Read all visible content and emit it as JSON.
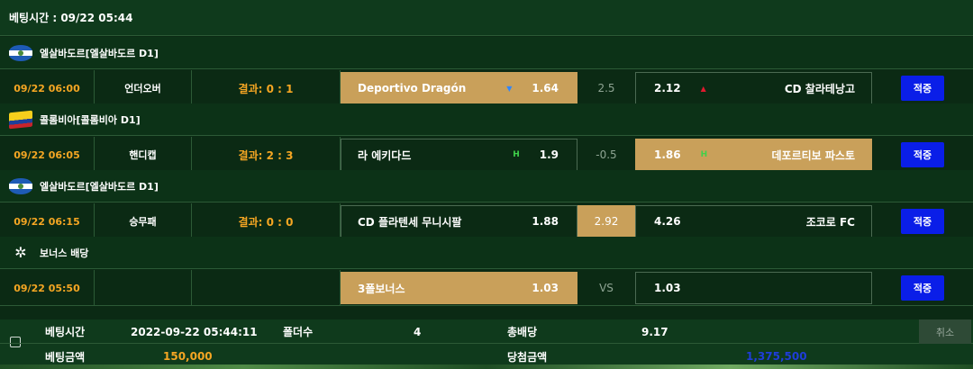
{
  "header": {
    "bet_time_label": "베팅시간 : 09/22 05:44"
  },
  "leagues": [
    {
      "name": "엘살바도르[엘살바도르 D1]",
      "flag": "el-salvador-flag-icon"
    },
    {
      "name": "콜롬비아[콜롬비아 D1]",
      "flag": "colombia-flag-icon"
    },
    {
      "name": "엘살바도르[엘살바도르 D1]",
      "flag": "el-salvador-flag-icon"
    },
    {
      "name": "보너스 배당",
      "flag": "bonus-icon"
    }
  ],
  "rows": [
    {
      "time": "09/22 06:00",
      "type": "언더오버",
      "result": "결과: 0 : 1",
      "home": "Deportivo Dragón",
      "home_odds": "1.64",
      "home_mark": "▼",
      "mid": "2.5",
      "away_odds": "2.12",
      "away_mark": "▲",
      "away": "CD 찰라테낭고",
      "selected": "home",
      "bet_label": "적중"
    },
    {
      "time": "09/22 06:05",
      "type": "핸디캡",
      "result": "결과: 2 : 3",
      "home": "라 에키다드",
      "home_odds": "1.9",
      "home_mark": "H",
      "mid": "-0.5",
      "away_odds": "1.86",
      "away_mark": "H",
      "away": "데포르티보 파스토",
      "selected": "away",
      "bet_label": "적중"
    },
    {
      "time": "09/22 06:15",
      "type": "승무패",
      "result": "결과: 0 : 0",
      "home": "CD 플라텐세 무니시팔",
      "home_odds": "1.88",
      "home_mark": "",
      "mid": "2.92",
      "away_odds": "4.26",
      "away_mark": "",
      "away": "조코로 FC",
      "selected": "mid",
      "bet_label": "적중"
    },
    {
      "time": "09/22 05:50",
      "type": "",
      "result": "",
      "home": "3폴보너스",
      "home_odds": "1.03",
      "home_mark": "",
      "mid": "VS",
      "away_odds": "1.03",
      "away_mark": "",
      "away": "",
      "selected": "home",
      "bet_label": "적중"
    }
  ],
  "footer": {
    "bet_time_label": "베팅시간",
    "bet_time_value": "2022-09-22 05:44:11",
    "folder_label": "폴더수",
    "folder_value": "4",
    "total_odds_label": "총배당",
    "total_odds_value": "9.17",
    "bet_amount_label": "베팅금액",
    "bet_amount_value": "150,000",
    "win_amount_label": "당첨금액",
    "win_amount_value": "1,375,500",
    "cancel_label": "취소"
  },
  "colors": {
    "accent_selected": "#c9a05a",
    "bet_button": "#0a1ee8",
    "result_text": "#f5a623",
    "win_amount": "#1f3dd9"
  }
}
